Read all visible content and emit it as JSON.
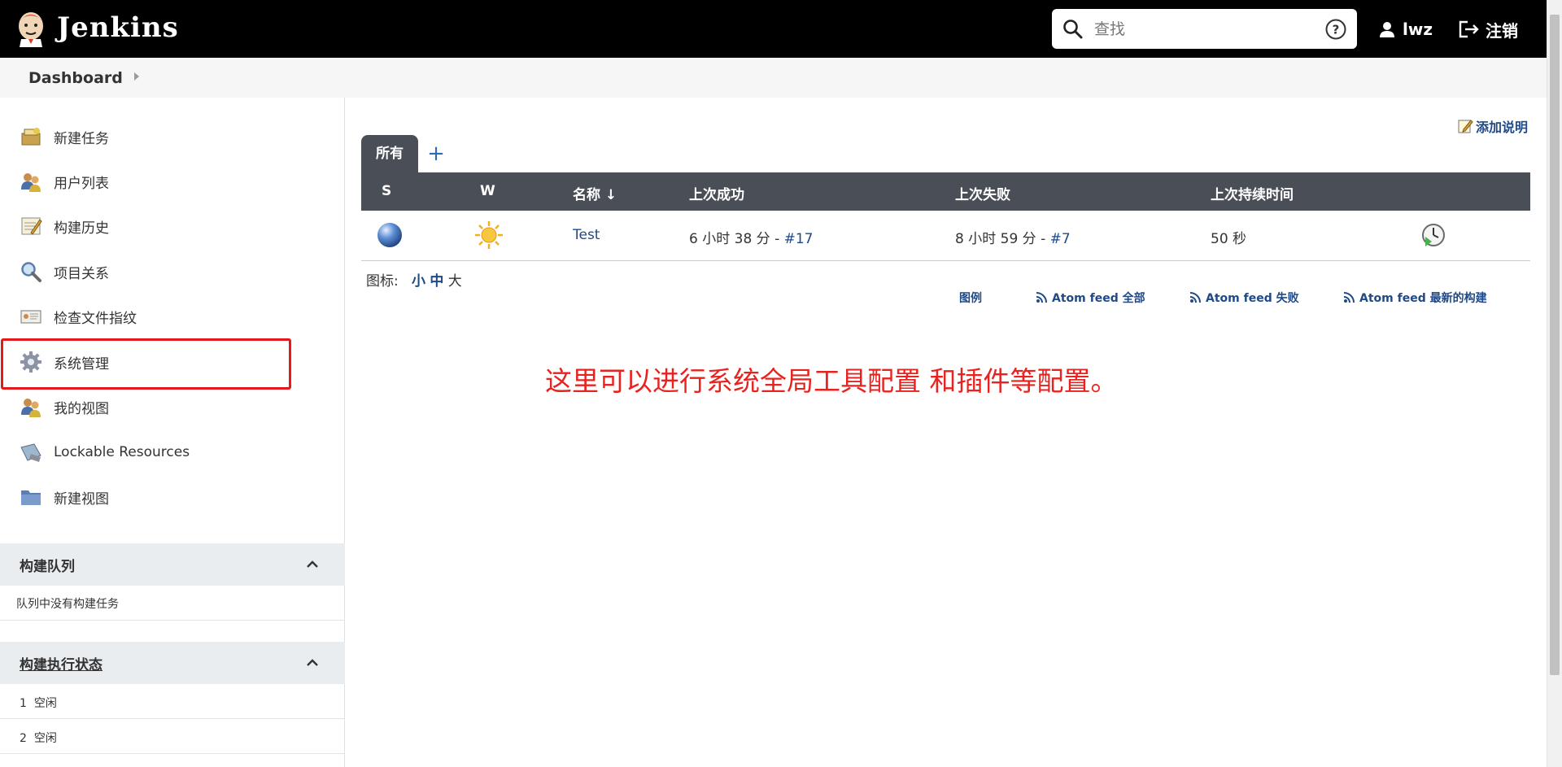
{
  "header": {
    "brand": "Jenkins",
    "search_placeholder": "查找",
    "user": "lwz",
    "logout": "注销"
  },
  "breadcrumb": {
    "item": "Dashboard"
  },
  "sidebar": {
    "tasks": [
      {
        "label": "新建任务",
        "icon": "new-item-icon"
      },
      {
        "label": "用户列表",
        "icon": "users-icon"
      },
      {
        "label": "构建历史",
        "icon": "build-history-icon"
      },
      {
        "label": "项目关系",
        "icon": "search-icon"
      },
      {
        "label": "检查文件指纹",
        "icon": "fingerprint-icon"
      },
      {
        "label": "系统管理",
        "icon": "gear-icon"
      },
      {
        "label": "我的视图",
        "icon": "user-view-icon"
      },
      {
        "label": "Lockable Resources",
        "icon": "lock-resource-icon"
      },
      {
        "label": "新建视图",
        "icon": "folder-icon"
      }
    ],
    "queue": {
      "title": "构建队列",
      "empty": "队列中没有构建任务"
    },
    "executors": {
      "title": "构建执行状态",
      "rows": [
        {
          "num": "1",
          "state": "空闲"
        },
        {
          "num": "2",
          "state": "空闲"
        }
      ]
    }
  },
  "main": {
    "add_description": "添加说明",
    "tabs": {
      "active": "所有",
      "add": "+"
    },
    "columns": {
      "s": "S",
      "w": "W",
      "name": "名称 ↓",
      "last_success": "上次成功",
      "last_failure": "上次失败",
      "last_duration": "上次持续时间"
    },
    "jobs": [
      {
        "name": "Test",
        "last_success_text": "6 小时 38 分 - ",
        "last_success_build": "#17",
        "last_failure_text": "8 小时 59 分 - ",
        "last_failure_build": "#7",
        "duration": "50 秒"
      }
    ],
    "icon_size": {
      "label": "图标:",
      "small": "小",
      "medium": "中",
      "large": "大"
    },
    "feeds": {
      "legend": "图例",
      "all": "Atom feed 全部",
      "failed": "Atom feed 失败",
      "latest": "Atom feed 最新的构建"
    },
    "annotation": "这里可以进行系统全局工具配置 和插件等配置。"
  },
  "colors": {
    "header_bg": "#000000",
    "table_header_bg": "#4a4f57",
    "link": "#204a87",
    "annotation": "#e8231f",
    "highlight_border": "#e4191c"
  }
}
